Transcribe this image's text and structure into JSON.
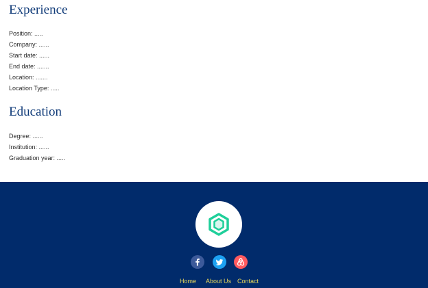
{
  "experience": {
    "title": "Experience",
    "fields": {
      "position": "Position: .....",
      "company": "Company: ......",
      "start_date": "Start date: ......",
      "end_date": "End date: .......",
      "location": "Location: .......",
      "location_type": "Location Type: ....."
    }
  },
  "education": {
    "title": "Education",
    "fields": {
      "degree": "Degree: ......",
      "institution": "Institution: ......",
      "graduation_year": "Graduation year: ....."
    }
  },
  "footer": {
    "logo_icon": "hexagon-logo-icon",
    "social": {
      "facebook_icon": "facebook-icon",
      "twitter_icon": "twitter-icon",
      "airbnb_icon": "airbnb-icon"
    },
    "links": {
      "home": "Home",
      "about": "About Us",
      "contact": "Contact"
    }
  },
  "colors": {
    "heading": "#0f3a78",
    "footer_bg": "#012b6b",
    "footer_link": "#e8d85a",
    "logo_accent": "#1fcf9a",
    "facebook": "#3c5a9a",
    "twitter": "#1da1f2",
    "airbnb": "#ff5a5f"
  }
}
